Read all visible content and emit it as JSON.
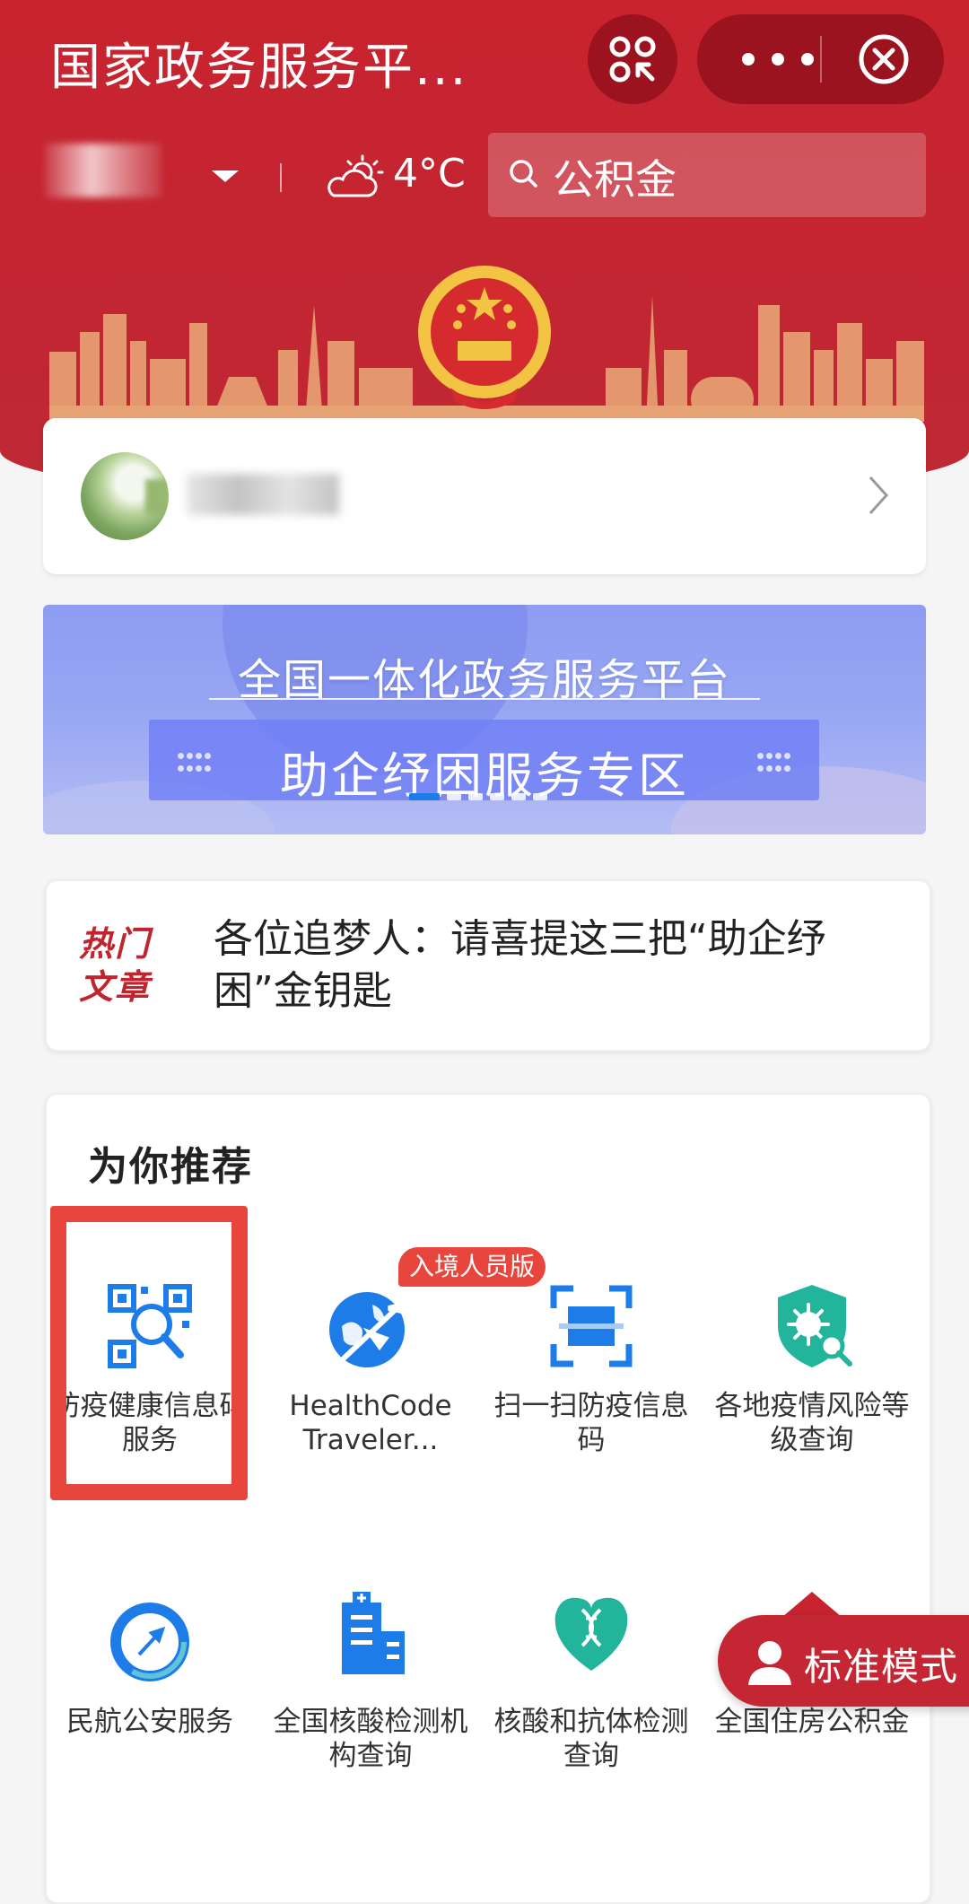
{
  "header": {
    "title": "国家政务服务平...",
    "temperature": "4°C",
    "search_placeholder": "公积金"
  },
  "user_card": {},
  "banner": {
    "line1": "全国一体化政务服务平台",
    "line2": "助企纾困服务专区",
    "slide_count": 6,
    "active_slide": 1
  },
  "hot": {
    "label": "热门文章",
    "text": "各位追梦人：请喜提这三把“助企纾困”金钥匙"
  },
  "recommend": {
    "title": "为你推荐",
    "badge": "入境人员版",
    "items": [
      {
        "label": "防疫健康信息码服务",
        "icon": "qr-search-icon"
      },
      {
        "label": "HealthCode Traveler...",
        "icon": "globe-plane-icon"
      },
      {
        "label": "扫一扫防疫信息码",
        "icon": "scan-frame-icon"
      },
      {
        "label": "各地疫情风险等级查询",
        "icon": "shield-virus-icon"
      },
      {
        "label": "民航公安服务",
        "icon": "aviation-police-icon"
      },
      {
        "label": "全国核酸检测机构查询",
        "icon": "hospital-icon"
      },
      {
        "label": "核酸和抗体检测查询",
        "icon": "dna-heart-icon"
      },
      {
        "label": "全国住房公积金",
        "icon": "house-icon"
      }
    ]
  },
  "mode_button": {
    "label": "标准模式"
  },
  "colors": {
    "brand_red": "#c8232f",
    "highlight": "#e8453c",
    "blue": "#1e7ce8",
    "teal": "#22b59b"
  }
}
